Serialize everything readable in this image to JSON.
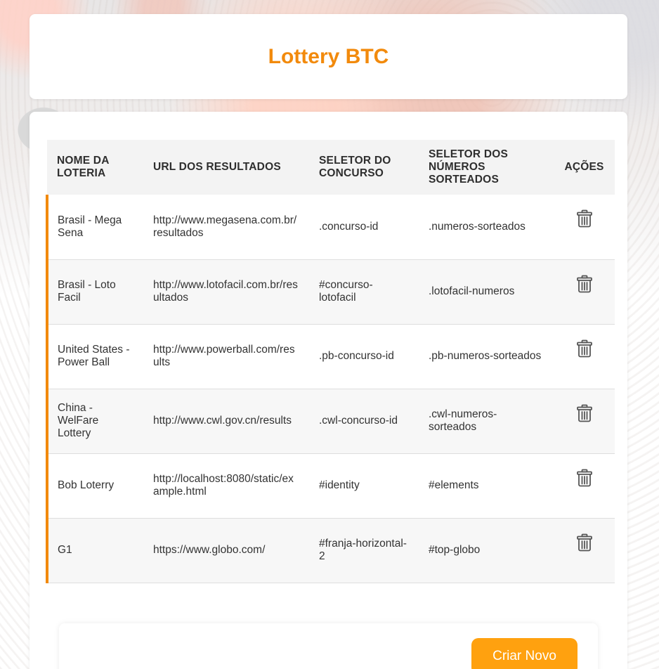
{
  "app": {
    "title": "Lottery BTC",
    "accent_color": "#f28a0c",
    "button_color": "#ffa10f"
  },
  "table": {
    "headers": {
      "name": "NOME DA LOTERIA",
      "url": "URL DOS RESULTADOS",
      "contest_selector": "SELETOR DO CONCURSO",
      "numbers_selector": "SELETOR DOS NÚMEROS SORTEADOS",
      "actions": "AÇÕES"
    },
    "rows": [
      {
        "name": "Brasil - Mega Sena",
        "url": "http://www.megasena.com.br/resultados",
        "contest_selector": ".concurso-id",
        "numbers_selector": ".numeros-sorteados",
        "action_icon": "trash-icon"
      },
      {
        "name": "Brasil - Loto Facil",
        "url": "http://www.lotofacil.com.br/resultados",
        "contest_selector": "#concurso-lotofacil",
        "numbers_selector": ".lotofacil-numeros",
        "action_icon": "trash-icon"
      },
      {
        "name": "United States - Power Ball",
        "url": "http://www.powerball.com/results",
        "contest_selector": ".pb-concurso-id",
        "numbers_selector": ".pb-numeros-sorteados",
        "action_icon": "trash-icon"
      },
      {
        "name": "China - WelFare Lottery",
        "url": "http://www.cwl.gov.cn/results",
        "contest_selector": ".cwl-concurso-id",
        "numbers_selector": ".cwl-numeros-sorteados",
        "action_icon": "trash-icon"
      },
      {
        "name": "Bob Loterry",
        "url": "http://localhost:8080/static/example.html",
        "contest_selector": "#identity",
        "numbers_selector": "#elements",
        "action_icon": "trash-icon"
      },
      {
        "name": "G1",
        "url": "https://www.globo.com/",
        "contest_selector": "#franja-horizontal-2",
        "numbers_selector": "#top-globo",
        "action_icon": "trash-icon"
      }
    ]
  },
  "footer": {
    "create_label": "Criar Novo"
  }
}
